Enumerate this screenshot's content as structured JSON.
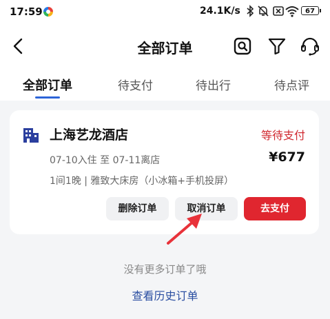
{
  "status_bar": {
    "time": "17:59",
    "net_speed": "24.1K/s",
    "battery": "67"
  },
  "nav": {
    "title": "全部订单",
    "icons": [
      "back-arrow-icon",
      "search-icon",
      "filter-icon",
      "customer-service-icon"
    ]
  },
  "tabs": [
    {
      "label": "全部订单",
      "active": true
    },
    {
      "label": "待支付",
      "active": false
    },
    {
      "label": "待出行",
      "active": false
    },
    {
      "label": "待点评",
      "active": false
    }
  ],
  "order": {
    "hotel_name": "上海艺龙酒店",
    "status": "等待支付",
    "dates": "07-10入住 至 07-11离店",
    "price": "¥677",
    "room_info": "1间1晚 | 雅致大床房（小冰箱+手机投屏）",
    "buttons": {
      "delete": "删除订单",
      "cancel": "取消订单",
      "pay": "去支付"
    }
  },
  "footer": {
    "no_more": "没有更多订单了哦",
    "history_link": "查看历史订单"
  },
  "colors": {
    "accent_blue": "#2c64d8",
    "status_red": "#d0282f",
    "pay_button": "#e0262f",
    "link_blue": "#2a4ea1",
    "hotel_icon": "#2b3f9e",
    "annotation_arrow": "#e8323a"
  }
}
